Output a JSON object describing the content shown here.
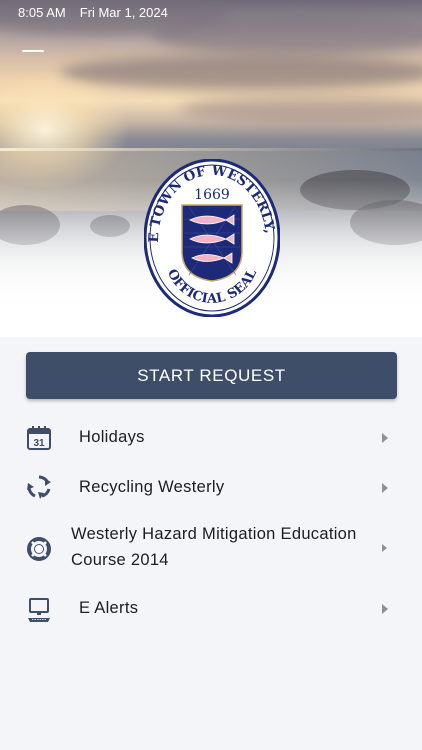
{
  "status_bar": {
    "time": "8:05 AM",
    "date": "Fri Mar 1, 2024"
  },
  "seal": {
    "top_text": "THE TOWN OF WESTERLY, R.I.",
    "year": "1669",
    "bottom_text": "OFFICIAL SEAL"
  },
  "start_request": {
    "label": "START REQUEST"
  },
  "menu": [
    {
      "label": "Holidays",
      "icon": "calendar-icon"
    },
    {
      "label": "Recycling Westerly",
      "icon": "recycle-icon"
    },
    {
      "label": "Westerly Hazard Mitigation Education Course 2014",
      "icon": "lifebuoy-icon"
    },
    {
      "label": "E Alerts",
      "icon": "computer-icon"
    }
  ],
  "colors": {
    "button": "#3e4e68",
    "icon": "#3e4e68",
    "seal_navy": "#1c2a78",
    "background": "#f4f5f8"
  }
}
